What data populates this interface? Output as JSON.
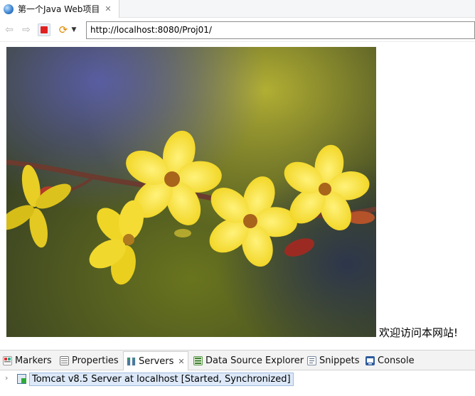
{
  "editor_tab": {
    "title": "第一个Java Web项目"
  },
  "toolbar": {
    "url": "http://localhost:8080/Proj01/"
  },
  "page": {
    "welcome_text": "欢迎访问本网站!"
  },
  "views": {
    "markers": "Markers",
    "properties": "Properties",
    "servers": "Servers",
    "data_source_explorer": "Data Source Explorer",
    "snippets": "Snippets",
    "console": "Console"
  },
  "servers_panel": {
    "server_label": "Tomcat v8.5 Server at localhost  [Started, Synchronized]"
  }
}
